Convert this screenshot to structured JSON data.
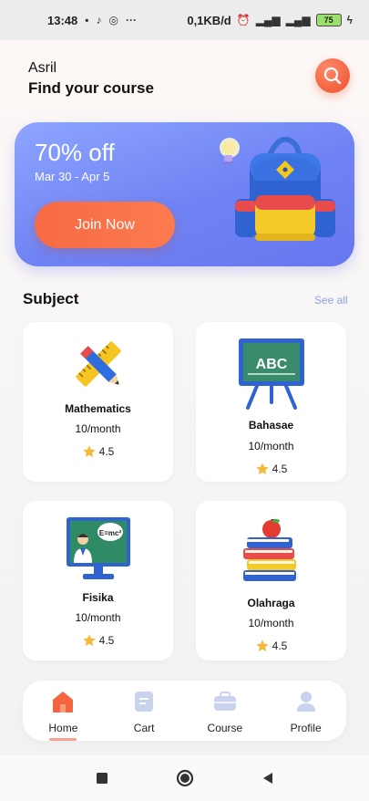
{
  "status_bar": {
    "time": "13:48",
    "network_speed": "0,1KB/d",
    "battery": "75",
    "more": "···"
  },
  "header": {
    "user_name": "Asril",
    "title": "Find your course"
  },
  "banner": {
    "discount": "70% off",
    "dates": "Mar 30 - Apr 5",
    "button_label": "Join Now"
  },
  "subject": {
    "title": "Subject",
    "see_all": "See all",
    "cards": [
      {
        "name": "Mathematics",
        "price": "10/month",
        "rating": "4.5"
      },
      {
        "name": "Bahasae",
        "price": "10/month",
        "rating": "4.5"
      },
      {
        "name": "Fisika",
        "price": "10/month",
        "rating": "4.5"
      },
      {
        "name": "Olahraga",
        "price": "10/month",
        "rating": "4.5"
      }
    ]
  },
  "nav": {
    "items": [
      {
        "label": "Home",
        "icon": "home-icon",
        "active": true
      },
      {
        "label": "Cart",
        "icon": "cart-icon"
      },
      {
        "label": "Course",
        "icon": "course-icon"
      },
      {
        "label": "Profile",
        "icon": "profile-icon"
      }
    ]
  },
  "board_text": "ABC",
  "screen_text": "E=mc²",
  "colors": {
    "accent": "#f4653f",
    "banner": "#7688f2",
    "see_all": "#8fa2e6",
    "star": "#f5b93a",
    "inactive_icon": "#c9d3f0"
  }
}
